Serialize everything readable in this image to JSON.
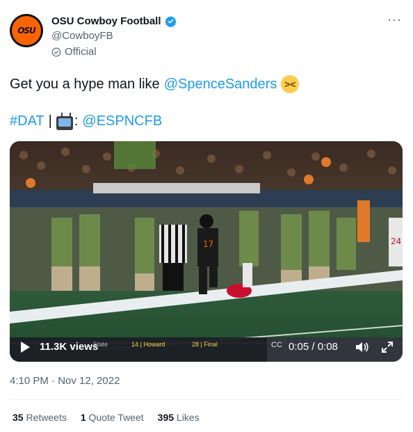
{
  "header": {
    "display_name": "OSU Cowboy Football",
    "handle": "@CowboyFB",
    "official_label": "Official",
    "avatar_text": "OSU",
    "more_label": "···"
  },
  "tweet": {
    "text_prefix": "Get you a hype man like",
    "mention": "@SpenceSanders",
    "emoji_name": "face-with-steam-from-nose",
    "hashtag": "#DAT",
    "separator": "|",
    "tv_colon": ":",
    "mention2": "@ESPNCFB"
  },
  "video": {
    "views": "11.3K views",
    "time": "0:05 / 0:08",
    "scorebug_left": "State",
    "scorebug_mid": "14 | Howard",
    "scorebug_right": "28 | Final",
    "scorebug_far": "CC"
  },
  "meta": {
    "timestamp": "4:10 PM · Nov 12, 2022"
  },
  "stats": {
    "retweets_count": "35",
    "retweets_label": "Retweets",
    "quotes_count": "1",
    "quotes_label": "Quote Tweet",
    "likes_count": "395",
    "likes_label": "Likes"
  },
  "colors": {
    "link": "#1d9bf0",
    "brand_orange": "#fa6400",
    "verified": "#1d9bf0"
  }
}
